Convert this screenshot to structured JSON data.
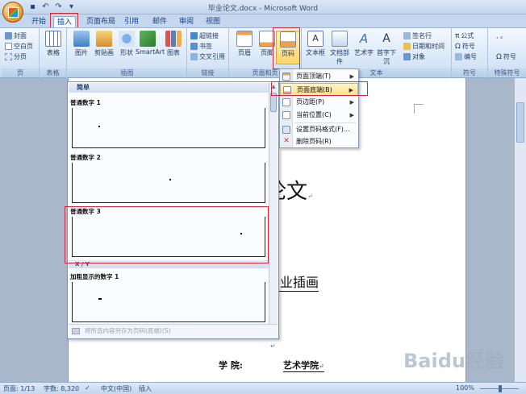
{
  "window": {
    "title": "毕业论文.docx - Microsoft Word"
  },
  "tabs": [
    "开始",
    "插入",
    "页面布局",
    "引用",
    "邮件",
    "审阅",
    "视图"
  ],
  "ribbon": {
    "page_group": {
      "label": "页",
      "items": [
        "封面",
        "空白页",
        "分页"
      ]
    },
    "table_group": {
      "label": "表格",
      "button": "表格"
    },
    "illustration_group": {
      "label": "插图",
      "buttons": [
        "图片",
        "剪贴画",
        "形状",
        "SmartArt",
        "图表"
      ]
    },
    "link_group": {
      "label": "链接",
      "items": [
        "超链接",
        "书签",
        "交叉引用"
      ]
    },
    "header_footer_group": {
      "label": "页眉和页",
      "buttons": [
        "页眉",
        "页脚",
        "页码"
      ]
    },
    "text_group": {
      "label": "文本",
      "buttons": [
        "文本框",
        "文档部件",
        "艺术字",
        "首字下沉"
      ],
      "items": [
        "签名行",
        "日期和时间",
        "对象"
      ]
    },
    "symbol_group": {
      "label": "符号",
      "items": [
        "公式",
        "符号",
        "编号"
      ]
    },
    "special_group": {
      "label": "特殊符号",
      "items": [
        "符号"
      ]
    }
  },
  "menu": {
    "items": [
      {
        "label": "页面顶端(T)",
        "has_sub": true
      },
      {
        "label": "页面底端(B)",
        "has_sub": true
      },
      {
        "label": "页边距(P)",
        "has_sub": true
      },
      {
        "label": "当前位置(C)",
        "has_sub": true
      },
      {
        "label": "设置页码格式(F)...",
        "has_sub": false
      },
      {
        "label": "删除页码(R)",
        "has_sub": false
      }
    ]
  },
  "gallery": {
    "header": "简单",
    "items": [
      "普通数字 1",
      "普通数字 2",
      "普通数字 3"
    ],
    "section2": "X / Y",
    "item4": "加粗显示的数字 1",
    "footer": "将所选内容另存为页码(底端)(S)"
  },
  "document": {
    "title_fragment": "论文",
    "subtitle_fragment": "商业插画",
    "college_label": "学    院:",
    "college_value": "艺术学院",
    "para_mark": "↵"
  },
  "statusbar": {
    "page": "页面: 1/13",
    "words": "字数: 8,320",
    "language": "中文(中国)",
    "mode": "插入",
    "zoom": "100%"
  },
  "watermark": "Baidu经验"
}
